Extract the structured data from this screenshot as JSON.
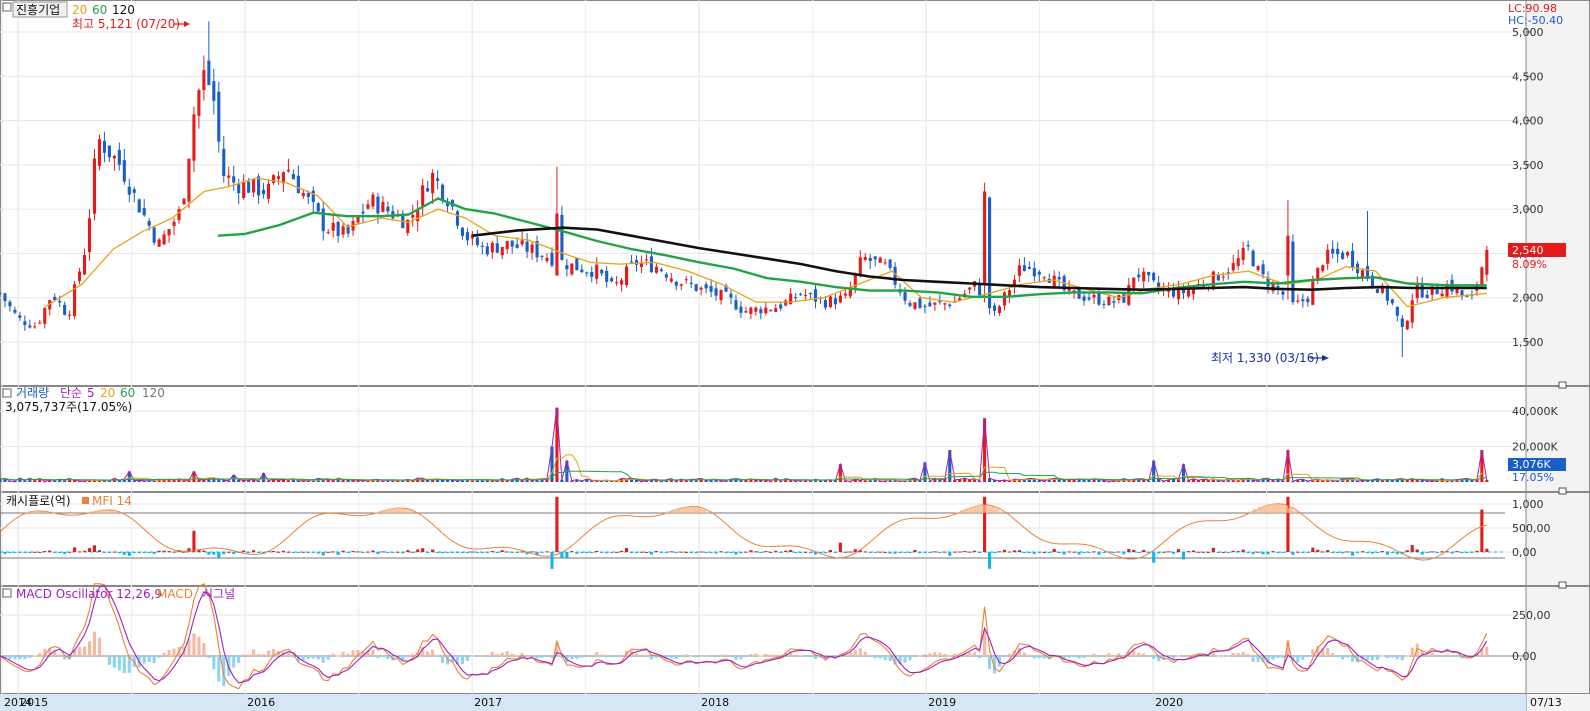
{
  "price_panel": {
    "stock_name": "진흥기업",
    "ma_labels": [
      "20",
      "60",
      "120"
    ],
    "lc": "LC:90.98",
    "hc": "HC:-50.40",
    "high_marker": "최고 5,121 (07/20)",
    "low_marker": "최저 1,330 (03/16)",
    "current_price": "2,540",
    "current_change": "8.09%"
  },
  "volume_panel": {
    "title": "거래량",
    "sma_label": "단순",
    "periods": [
      "5",
      "20",
      "60",
      "120"
    ],
    "info": "3,075,737주(17.05%)",
    "current_value": "3,076K",
    "current_pct": "17.05%"
  },
  "mfi_panel": {
    "title": "캐시플로(억)",
    "indicator": "MFI 14"
  },
  "macd_panel": {
    "title": "MACD Oscillator 12,26,9",
    "macd_label": "MACD",
    "signal_label": "시그널"
  },
  "date_label": "07/13",
  "colors": {
    "up": "#e31b1b",
    "down": "#1a5ec7",
    "ma20": "#e8a317",
    "ma60": "#22a34a",
    "ma120": "#111111",
    "volume_ma5": "#a020c0",
    "mfi": "#e8823a",
    "macd_up": "#f4b9a0",
    "macd_down": "#8fd3f0",
    "cash_neg": "#10b4f0"
  },
  "chart_data": [
    {
      "type": "candlestick",
      "title": "진흥기업",
      "x_labels": [
        "2014",
        "2015",
        "2016",
        "2017",
        "2018",
        "2019",
        "2020"
      ],
      "y_ticks": [
        "5,000",
        "4,500",
        "4,000",
        "3,500",
        "3,000",
        "2,500",
        "2,000",
        "1,500"
      ],
      "ylim": [
        1150,
        5200
      ],
      "period": {
        "start": "2014-12",
        "end": "2020-07"
      },
      "annotations": {
        "max": {
          "value": 5121,
          "date": "07/20"
        },
        "min": {
          "value": 1330,
          "date": "03/16"
        },
        "last": 2540
      },
      "close_path": [
        [
          2014.92,
          2050
        ],
        [
          2015.0,
          1760
        ],
        [
          2015.08,
          1680
        ],
        [
          2015.15,
          2050
        ],
        [
          2015.22,
          1800
        ],
        [
          2015.3,
          2600
        ],
        [
          2015.35,
          3800
        ],
        [
          2015.45,
          3500
        ],
        [
          2015.52,
          3100
        ],
        [
          2015.62,
          2600
        ],
        [
          2015.72,
          3000
        ],
        [
          2015.78,
          4200
        ],
        [
          2015.84,
          4700
        ],
        [
          2015.9,
          3400
        ],
        [
          2015.95,
          3300
        ],
        [
          2016.02,
          3250
        ],
        [
          2016.1,
          3200
        ],
        [
          2016.18,
          3500
        ],
        [
          2016.25,
          3200
        ],
        [
          2016.35,
          2800
        ],
        [
          2016.45,
          2700
        ],
        [
          2016.55,
          3100
        ],
        [
          2016.65,
          2950
        ],
        [
          2016.72,
          2850
        ],
        [
          2016.82,
          3400
        ],
        [
          2016.9,
          3100
        ],
        [
          2016.97,
          2700
        ],
        [
          2017.05,
          2550
        ],
        [
          2017.15,
          2600
        ],
        [
          2017.25,
          2550
        ],
        [
          2017.35,
          2450
        ],
        [
          2017.45,
          2350
        ],
        [
          2017.55,
          2300
        ],
        [
          2017.62,
          2100
        ],
        [
          2017.72,
          2400
        ],
        [
          2017.82,
          2350
        ],
        [
          2017.9,
          2200
        ],
        [
          2018.0,
          2100
        ],
        [
          2018.12,
          2000
        ],
        [
          2018.2,
          1850
        ],
        [
          2018.35,
          1900
        ],
        [
          2018.45,
          2050
        ],
        [
          2018.55,
          1950
        ],
        [
          2018.65,
          2000
        ],
        [
          2018.72,
          2450
        ],
        [
          2018.82,
          2350
        ],
        [
          2018.92,
          1950
        ],
        [
          2019.0,
          1900
        ],
        [
          2019.12,
          1950
        ],
        [
          2019.22,
          2150
        ],
        [
          2019.3,
          1800
        ],
        [
          2019.42,
          2350
        ],
        [
          2019.52,
          2300
        ],
        [
          2019.62,
          2050
        ],
        [
          2019.72,
          2000
        ],
        [
          2019.82,
          1950
        ],
        [
          2019.88,
          2000
        ],
        [
          2019.92,
          2300
        ],
        [
          2020.02,
          2100
        ],
        [
          2020.12,
          2050
        ],
        [
          2020.25,
          2200
        ],
        [
          2020.35,
          2350
        ],
        [
          2020.42,
          2550
        ],
        [
          2020.47,
          2250
        ],
        [
          2020.55,
          2100
        ],
        [
          2020.62,
          1900
        ],
        [
          2020.68,
          2000
        ],
        [
          2020.75,
          2450
        ],
        [
          2020.85,
          2500
        ],
        [
          2020.92,
          2300
        ],
        [
          2020.98,
          2150
        ],
        [
          2021.05,
          1950
        ],
        [
          2021.1,
          1600
        ],
        [
          2021.15,
          2100
        ],
        [
          2021.22,
          2050
        ],
        [
          2021.3,
          2150
        ],
        [
          2021.4,
          1950
        ],
        [
          2021.47,
          2540
        ]
      ],
      "ma20_path": [
        [
          2015.12,
          1900
        ],
        [
          2015.28,
          2150
        ],
        [
          2015.42,
          2550
        ],
        [
          2015.55,
          2750
        ],
        [
          2015.68,
          2900
        ],
        [
          2015.82,
          3200
        ],
        [
          2015.92,
          3250
        ],
        [
          2016.05,
          3350
        ],
        [
          2016.18,
          3300
        ],
        [
          2016.32,
          3150
        ],
        [
          2016.45,
          2800
        ],
        [
          2016.6,
          2900
        ],
        [
          2016.72,
          2850
        ],
        [
          2016.85,
          3000
        ],
        [
          2016.97,
          2900
        ],
        [
          2017.1,
          2700
        ],
        [
          2017.25,
          2650
        ],
        [
          2017.4,
          2500
        ],
        [
          2017.52,
          2400
        ],
        [
          2017.65,
          2380
        ],
        [
          2017.8,
          2400
        ],
        [
          2017.95,
          2300
        ],
        [
          2018.1,
          2150
        ],
        [
          2018.25,
          1950
        ],
        [
          2018.4,
          1950
        ],
        [
          2018.55,
          2000
        ],
        [
          2018.7,
          2150
        ],
        [
          2018.85,
          2300
        ],
        [
          2018.98,
          2000
        ],
        [
          2019.12,
          1950
        ],
        [
          2019.28,
          2050
        ],
        [
          2019.42,
          2150
        ],
        [
          2019.56,
          2200
        ],
        [
          2019.7,
          2100
        ],
        [
          2019.85,
          2000
        ],
        [
          2019.98,
          2100
        ],
        [
          2020.12,
          2150
        ],
        [
          2020.26,
          2250
        ],
        [
          2020.42,
          2300
        ],
        [
          2020.58,
          2150
        ],
        [
          2020.72,
          2200
        ],
        [
          2020.85,
          2350
        ],
        [
          2020.98,
          2300
        ],
        [
          2021.12,
          1900
        ],
        [
          2021.28,
          2000
        ],
        [
          2021.47,
          2050
        ]
      ],
      "ma60_path": [
        [
          2015.88,
          2700
        ],
        [
          2016.0,
          2720
        ],
        [
          2016.15,
          2820
        ],
        [
          2016.3,
          2960
        ],
        [
          2016.45,
          2920
        ],
        [
          2016.6,
          2920
        ],
        [
          2016.72,
          2940
        ],
        [
          2016.85,
          3120
        ],
        [
          2016.97,
          3000
        ],
        [
          2017.1,
          2950
        ],
        [
          2017.25,
          2850
        ],
        [
          2017.4,
          2750
        ],
        [
          2017.55,
          2640
        ],
        [
          2017.7,
          2550
        ],
        [
          2017.85,
          2480
        ],
        [
          2018.0,
          2400
        ],
        [
          2018.15,
          2330
        ],
        [
          2018.3,
          2220
        ],
        [
          2018.45,
          2180
        ],
        [
          2018.6,
          2120
        ],
        [
          2018.75,
          2080
        ],
        [
          2018.9,
          2080
        ],
        [
          2019.05,
          2060
        ],
        [
          2019.2,
          2010
        ],
        [
          2019.35,
          2010
        ],
        [
          2019.5,
          2040
        ],
        [
          2019.65,
          2060
        ],
        [
          2019.8,
          2060
        ],
        [
          2019.95,
          2050
        ],
        [
          2020.1,
          2110
        ],
        [
          2020.25,
          2150
        ],
        [
          2020.4,
          2180
        ],
        [
          2020.55,
          2160
        ],
        [
          2020.7,
          2200
        ],
        [
          2020.85,
          2220
        ],
        [
          2020.98,
          2230
        ],
        [
          2021.12,
          2160
        ],
        [
          2021.3,
          2140
        ],
        [
          2021.47,
          2140
        ]
      ],
      "ma120_path": [
        [
          2017.0,
          2700
        ],
        [
          2017.2,
          2760
        ],
        [
          2017.4,
          2790
        ],
        [
          2017.55,
          2770
        ],
        [
          2017.7,
          2700
        ],
        [
          2017.85,
          2630
        ],
        [
          2018.0,
          2560
        ],
        [
          2018.15,
          2500
        ],
        [
          2018.3,
          2440
        ],
        [
          2018.45,
          2380
        ],
        [
          2018.6,
          2300
        ],
        [
          2018.75,
          2240
        ],
        [
          2018.9,
          2200
        ],
        [
          2019.05,
          2180
        ],
        [
          2019.2,
          2160
        ],
        [
          2019.35,
          2140
        ],
        [
          2019.5,
          2120
        ],
        [
          2019.65,
          2110
        ],
        [
          2019.8,
          2100
        ],
        [
          2019.95,
          2090
        ],
        [
          2020.1,
          2100
        ],
        [
          2020.25,
          2110
        ],
        [
          2020.4,
          2120
        ],
        [
          2020.55,
          2100
        ],
        [
          2020.7,
          2090
        ],
        [
          2020.85,
          2110
        ],
        [
          2021.0,
          2120
        ],
        [
          2021.15,
          2110
        ],
        [
          2021.3,
          2110
        ],
        [
          2021.47,
          2110
        ]
      ]
    },
    {
      "type": "bar",
      "title": "거래량",
      "y_ticks": [
        "40,000K",
        "20,000K"
      ],
      "ylim": [
        0,
        48000
      ],
      "spikes": [
        [
          2017.38,
          42000
        ],
        [
          2017.35,
          20000
        ],
        [
          2017.42,
          12000
        ],
        [
          2019.26,
          36000
        ],
        [
          2019.1,
          18000
        ],
        [
          2020.6,
          18000
        ],
        [
          2021.45,
          18000
        ],
        [
          2020.0,
          12000
        ],
        [
          2020.13,
          10000
        ],
        [
          2019.0,
          11000
        ],
        [
          2018.62,
          10000
        ],
        [
          2016.08,
          5000
        ],
        [
          2015.5,
          6000
        ],
        [
          2015.78,
          6000
        ],
        [
          2015.95,
          4000
        ]
      ],
      "ma5_spikes": [
        [
          2017.4,
          20000
        ],
        [
          2019.28,
          9000
        ],
        [
          2019.15,
          9000
        ]
      ],
      "last_value": 3076
    },
    {
      "type": "bar",
      "title": "캐시플로(억)",
      "y_ticks": [
        "1,000",
        "500,00",
        "0,00"
      ],
      "ylim": [
        -400,
        1200
      ],
      "mfi_series_scale": [
        0,
        100
      ]
    },
    {
      "type": "bar",
      "title": "MACD Oscillator 12,26,9",
      "y_ticks": [
        "250,00",
        "0,00"
      ],
      "ylim": [
        -280,
        450
      ]
    }
  ]
}
